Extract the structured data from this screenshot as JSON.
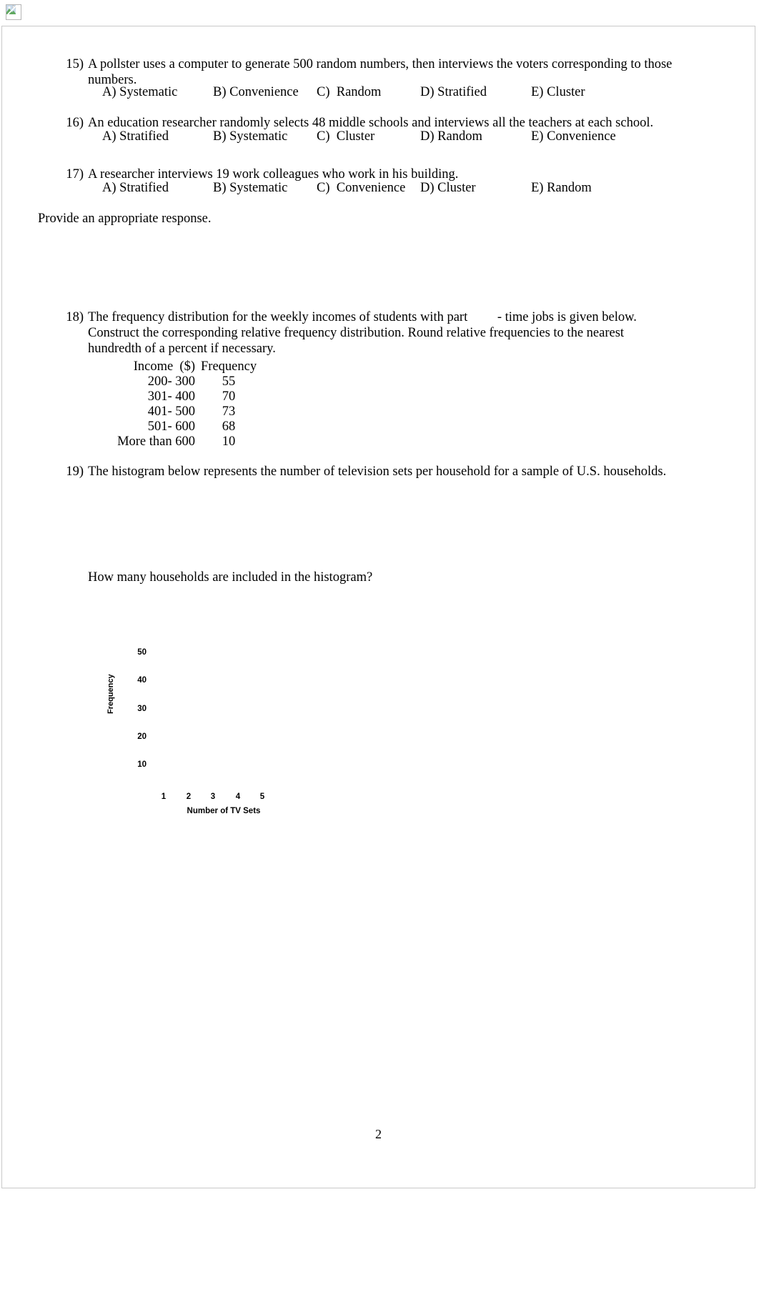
{
  "document": {
    "page_number": "2",
    "broken_image_alt": ""
  },
  "questions": [
    {
      "number": "15)",
      "lines": [
        "A pollster uses a computer to generate 500 random numbers, then interviews the voters corresponding to those",
        "numbers."
      ],
      "choices": [
        {
          "letter": "A)",
          "text": "Systematic"
        },
        {
          "letter": "B)",
          "text": "Convenience"
        },
        {
          "letter": "C)",
          "text": "Random"
        },
        {
          "letter": "D)",
          "text": "Stratified"
        },
        {
          "letter": "E)",
          "text": "Cluster"
        }
      ]
    },
    {
      "number": "16)",
      "lines": [
        "An education researcher randomly selects 48 middle schools and interviews all the teachers at each school."
      ],
      "choices": [
        {
          "letter": "A)",
          "text": "Stratified"
        },
        {
          "letter": "B)",
          "text": "Systematic"
        },
        {
          "letter": "C)",
          "text": "Cluster"
        },
        {
          "letter": "D)",
          "text": "Random"
        },
        {
          "letter": "E)",
          "text": "Convenience"
        }
      ]
    },
    {
      "number": "17)",
      "lines": [
        "A researcher interviews 19 work colleagues who work in his building."
      ],
      "choices": [
        {
          "letter": "A)",
          "text": "Stratified"
        },
        {
          "letter": "B)",
          "text": "Systematic"
        },
        {
          "letter": "C)",
          "text": "Convenience"
        },
        {
          "letter": "D)",
          "text": "Cluster"
        },
        {
          "letter": "E)",
          "text": "Random"
        }
      ]
    }
  ],
  "directive": "Provide an appropriate response.",
  "question18": {
    "number": "18)",
    "lines": [
      "The frequency distribution for the weekly incomes of students with part         - time jobs is given below.",
      "Construct the corresponding relative frequency distribution. Round relative frequencies to the nearest",
      "hundredth of a percent if necessary."
    ],
    "table": {
      "headers": [
        "Income  ($)",
        "Frequency"
      ],
      "rows": [
        [
          "200- 300",
          "55"
        ],
        [
          "301- 400",
          "70"
        ],
        [
          "401- 500",
          "73"
        ],
        [
          "501- 600",
          "68"
        ],
        [
          "More than 600",
          "10"
        ]
      ]
    }
  },
  "question19": {
    "number": "19)",
    "lines": [
      "The histogram below represents the number of television sets per household for a sample of U.S. households."
    ],
    "follow_up": "How many households are included in the histogram?"
  },
  "chart_data": {
    "type": "bar",
    "title": "",
    "xlabel": "Number of TV Sets",
    "ylabel": "Frequency",
    "categories": [
      "1",
      "2",
      "3",
      "4",
      "5"
    ],
    "values": [
      null,
      null,
      null,
      null,
      null
    ],
    "yticks": [
      "10",
      "20",
      "30",
      "40",
      "50"
    ],
    "ylim": [
      0,
      55
    ],
    "grid": false,
    "legend": "none",
    "note": "Bars not rendered in source image (embedded graphic missing)"
  }
}
